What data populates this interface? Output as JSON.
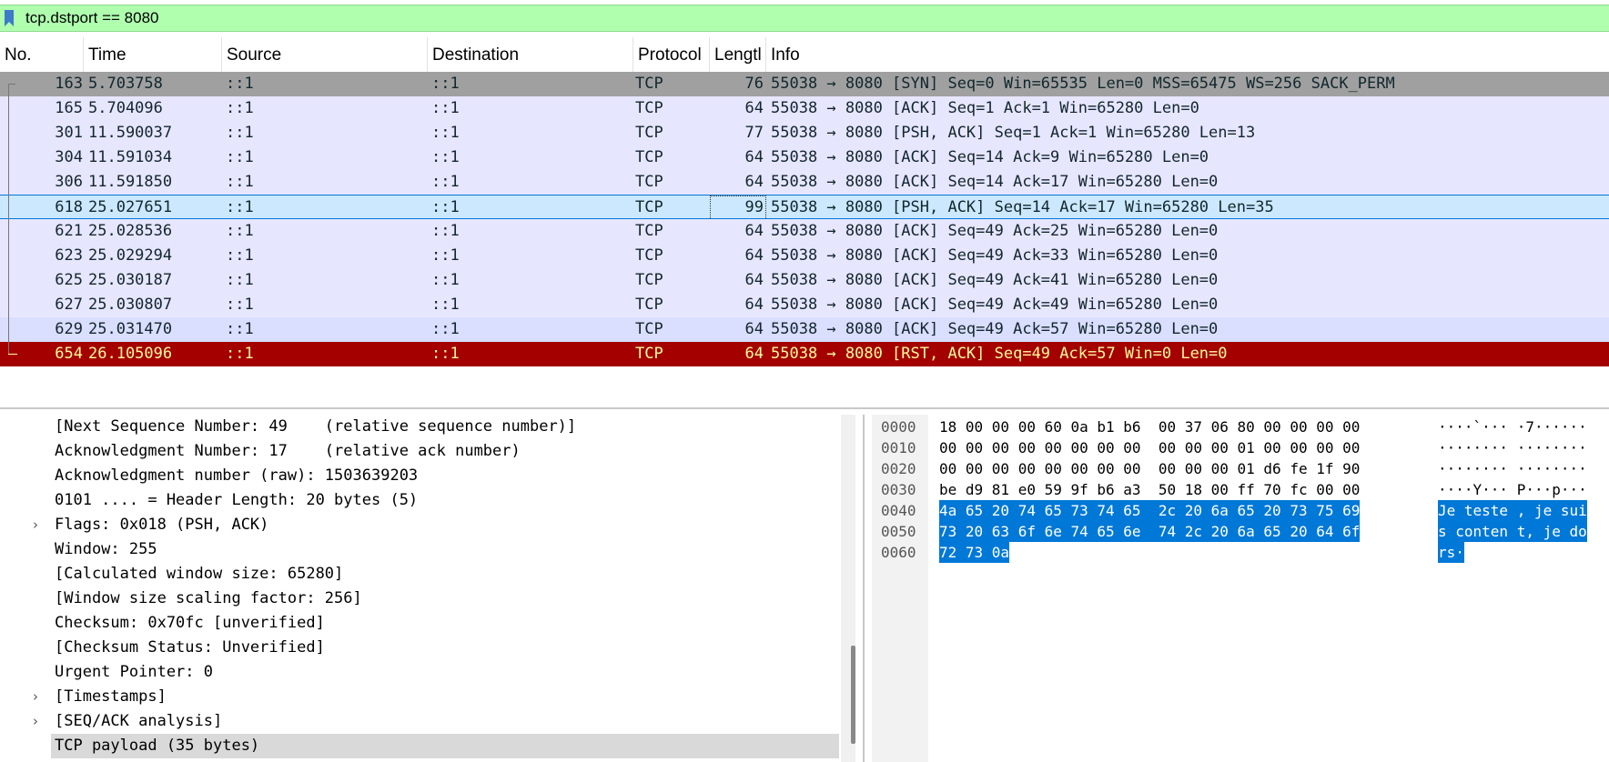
{
  "filter": {
    "text": "tcp.dstport == 8080"
  },
  "columns": [
    "No.",
    "Time",
    "Source",
    "Destination",
    "Protocol",
    "Lengtl",
    "Info"
  ],
  "packets": [
    {
      "no": "163",
      "time": "5.703758",
      "src": "::1",
      "dst": "::1",
      "proto": "TCP",
      "len": "76",
      "info": "55038 → 8080 [SYN] Seq=0 Win=65535 Len=0 MSS=65475 WS=256 SACK_PERM"
    },
    {
      "no": "165",
      "time": "5.704096",
      "src": "::1",
      "dst": "::1",
      "proto": "TCP",
      "len": "64",
      "info": "55038 → 8080 [ACK] Seq=1 Ack=1 Win=65280 Len=0"
    },
    {
      "no": "301",
      "time": "11.590037",
      "src": "::1",
      "dst": "::1",
      "proto": "TCP",
      "len": "77",
      "info": "55038 → 8080 [PSH, ACK] Seq=1 Ack=1 Win=65280 Len=13"
    },
    {
      "no": "304",
      "time": "11.591034",
      "src": "::1",
      "dst": "::1",
      "proto": "TCP",
      "len": "64",
      "info": "55038 → 8080 [ACK] Seq=14 Ack=9 Win=65280 Len=0"
    },
    {
      "no": "306",
      "time": "11.591850",
      "src": "::1",
      "dst": "::1",
      "proto": "TCP",
      "len": "64",
      "info": "55038 → 8080 [ACK] Seq=14 Ack=17 Win=65280 Len=0"
    },
    {
      "no": "618",
      "time": "25.027651",
      "src": "::1",
      "dst": "::1",
      "proto": "TCP",
      "len": "99",
      "info": "55038 → 8080 [PSH, ACK] Seq=14 Ack=17 Win=65280 Len=35"
    },
    {
      "no": "621",
      "time": "25.028536",
      "src": "::1",
      "dst": "::1",
      "proto": "TCP",
      "len": "64",
      "info": "55038 → 8080 [ACK] Seq=49 Ack=25 Win=65280 Len=0"
    },
    {
      "no": "623",
      "time": "25.029294",
      "src": "::1",
      "dst": "::1",
      "proto": "TCP",
      "len": "64",
      "info": "55038 → 8080 [ACK] Seq=49 Ack=33 Win=65280 Len=0"
    },
    {
      "no": "625",
      "time": "25.030187",
      "src": "::1",
      "dst": "::1",
      "proto": "TCP",
      "len": "64",
      "info": "55038 → 8080 [ACK] Seq=49 Ack=41 Win=65280 Len=0"
    },
    {
      "no": "627",
      "time": "25.030807",
      "src": "::1",
      "dst": "::1",
      "proto": "TCP",
      "len": "64",
      "info": "55038 → 8080 [ACK] Seq=49 Ack=49 Win=65280 Len=0"
    },
    {
      "no": "629",
      "time": "25.031470",
      "src": "::1",
      "dst": "::1",
      "proto": "TCP",
      "len": "64",
      "info": "55038 → 8080 [ACK] Seq=49 Ack=57 Win=65280 Len=0"
    },
    {
      "no": "654",
      "time": "26.105096",
      "src": "::1",
      "dst": "::1",
      "proto": "TCP",
      "len": "64",
      "info": "55038 → 8080 [RST, ACK] Seq=49 Ack=57 Win=0 Len=0"
    }
  ],
  "details": [
    {
      "text": "[Next Sequence Number: 49    (relative sequence number)]",
      "expandable": false
    },
    {
      "text": "Acknowledgment Number: 17    (relative ack number)",
      "expandable": false
    },
    {
      "text": "Acknowledgment number (raw): 1503639203",
      "expandable": false
    },
    {
      "text": "0101 .... = Header Length: 20 bytes (5)",
      "expandable": false
    },
    {
      "text": "Flags: 0x018 (PSH, ACK)",
      "expandable": true
    },
    {
      "text": "Window: 255",
      "expandable": false
    },
    {
      "text": "[Calculated window size: 65280]",
      "expandable": false
    },
    {
      "text": "[Window size scaling factor: 256]",
      "expandable": false
    },
    {
      "text": "Checksum: 0x70fc [unverified]",
      "expandable": false
    },
    {
      "text": "[Checksum Status: Unverified]",
      "expandable": false
    },
    {
      "text": "Urgent Pointer: 0",
      "expandable": false
    },
    {
      "text": "[Timestamps]",
      "expandable": true
    },
    {
      "text": "[SEQ/ACK analysis]",
      "expandable": true
    },
    {
      "text": "TCP payload (35 bytes)",
      "expandable": false
    }
  ],
  "hex": [
    {
      "offset": "0000",
      "bytes": "18 00 00 00 60 0a b1 b6  00 37 06 80 00 00 00 00",
      "ascii": "····`··· ·7······"
    },
    {
      "offset": "0010",
      "bytes": "00 00 00 00 00 00 00 00  00 00 00 01 00 00 00 00",
      "ascii": "········ ········"
    },
    {
      "offset": "0020",
      "bytes": "00 00 00 00 00 00 00 00  00 00 00 01 d6 fe 1f 90",
      "ascii": "········ ········"
    },
    {
      "offset": "0030",
      "bytes": "be d9 81 e0 59 9f b6 a3  50 18 00 ff 70 fc 00 00",
      "ascii": "····Y··· P···p···"
    },
    {
      "offset": "0040",
      "bytes": "4a 65 20 74 65 73 74 65  2c 20 6a 65 20 73 75 69",
      "ascii": "Je teste , je sui"
    },
    {
      "offset": "0050",
      "bytes": "73 20 63 6f 6e 74 65 6e  74 2c 20 6a 65 20 64 6f",
      "ascii": "s conten t, je do"
    },
    {
      "offset": "0060",
      "bytes": "72 73 0a",
      "ascii": "rs·"
    }
  ]
}
